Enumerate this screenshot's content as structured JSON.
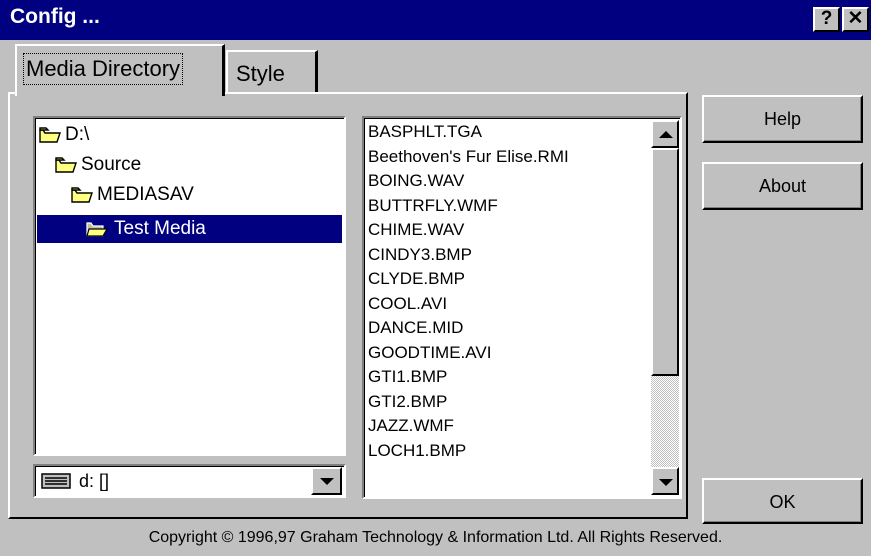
{
  "window": {
    "title": "Config ...",
    "help_glyph": "?",
    "close_glyph": "✕"
  },
  "tabs": [
    {
      "label": "Media Directory",
      "active": true
    },
    {
      "label": "Style",
      "active": false
    }
  ],
  "directory_tree": [
    {
      "label": "D:\\",
      "icon": "folder-closed-icon"
    },
    {
      "label": "Source",
      "icon": "folder-closed-icon"
    },
    {
      "label": "MEDIASAV",
      "icon": "folder-closed-icon"
    },
    {
      "label": "Test Media",
      "icon": "folder-open-icon",
      "selected": true
    }
  ],
  "drive_select": {
    "value": "d: []",
    "icon": "drive-icon"
  },
  "files": [
    "BASPHLT.TGA",
    "Beethoven's Fur Elise.RMI",
    "BOING.WAV",
    "BUTTRFLY.WMF",
    "CHIME.WAV",
    "CINDY3.BMP",
    "CLYDE.BMP",
    "COOL.AVI",
    "DANCE.MID",
    "GOODTIME.AVI",
    "GTI1.BMP",
    "GTI2.BMP",
    "JAZZ.WMF",
    "LOCH1.BMP"
  ],
  "buttons": {
    "help": "Help",
    "about": "About",
    "ok": "OK"
  },
  "footer": {
    "copyright": "Copyright © 1996,97 Graham Technology & Information Ltd. All Rights Reserved."
  },
  "colors": {
    "titlebar": "#000080",
    "face": "#c0c0c0",
    "selection": "#000080"
  }
}
